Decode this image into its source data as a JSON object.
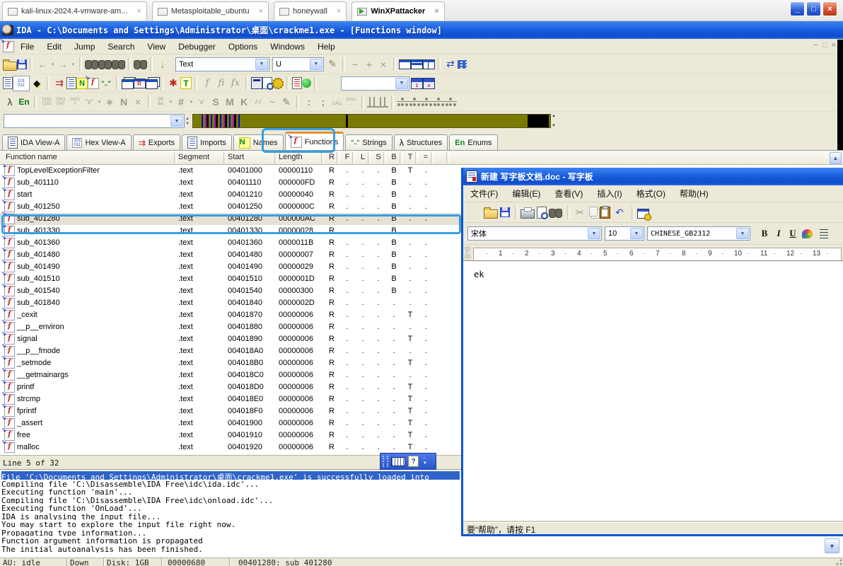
{
  "colors": {
    "titlebar_blue": "#1c5fdf",
    "toolbar_beige": "#ece9d8",
    "nav_band_olive": "#7a7a00",
    "selection_blue": "#2f63c8",
    "annotation_blue": "#389fe2"
  },
  "vm_tabs": [
    {
      "label": "kali-linux-2024.4-vmware-am...",
      "active": false
    },
    {
      "label": "Metasploitable_ubuntu",
      "active": false
    },
    {
      "label": "honeywall",
      "active": false
    },
    {
      "label": "WinXPattacker",
      "active": true
    }
  ],
  "vm_close_glyph": "×",
  "ida": {
    "title": "IDA - C:\\Documents and Settings\\Administrator\\桌面\\crackme1.exe - [Functions window]",
    "window_buttons": {
      "minimize": "_",
      "restore": "□",
      "close": "×"
    },
    "mdi_buttons": {
      "minimize": "−",
      "restore": "□",
      "close": "×"
    },
    "menus": [
      "File",
      "Edit",
      "Jump",
      "Search",
      "View",
      "Debugger",
      "Options",
      "Windows",
      "Help"
    ],
    "toolbar_row1": [
      {
        "n": "open-file-icon",
        "c": "ic-folder"
      },
      {
        "n": "save-file-icon",
        "c": "ic-floppy"
      },
      {
        "sep": true
      },
      {
        "n": "navigate-back-icon",
        "c": "dim big",
        "g": "←"
      },
      {
        "n": "navigate-back-dropdown-icon",
        "c": "dim tinyc",
        "g": "▾"
      },
      {
        "n": "navigate-forward-icon",
        "c": "dim big",
        "g": "→"
      },
      {
        "n": "navigate-forward-dropdown-icon",
        "c": "dim tinyc",
        "g": "▾"
      },
      {
        "sep": true
      },
      {
        "n": "search-memory-icon",
        "c": "ic-binoc"
      },
      {
        "n": "search-again-icon",
        "c": "ic-binoc"
      },
      {
        "n": "search-binary-icon",
        "c": "ic-binoc"
      },
      {
        "sep": true
      },
      {
        "n": "search-text-icon",
        "c": "ic-binoc"
      },
      {
        "sep": true
      },
      {
        "n": "jump-address-icon",
        "c": "dim big",
        "g": "↓"
      },
      {
        "combo": true,
        "n": "search-type-combo",
        "v": "Text",
        "c": "cb-text"
      },
      {
        "combo": true,
        "n": "search-direction-combo",
        "v": "U",
        "c": "cb-u"
      },
      {
        "n": "highlight-pencil-icon",
        "c": "pen",
        "g": "✎"
      },
      {
        "sep": true
      },
      {
        "n": "remove-item-icon",
        "c": "dim big",
        "g": "−"
      },
      {
        "n": "add-item-icon",
        "c": "dim big",
        "g": "+"
      },
      {
        "n": "delete-item-icon",
        "c": "dim big",
        "g": "×"
      },
      {
        "sep": true
      },
      {
        "n": "window-cascade-icon",
        "c": "ic-win"
      },
      {
        "n": "window-tile-horizontal-icon",
        "c": "ic-win w2"
      },
      {
        "n": "window-tile-vertical-icon",
        "c": "ic-win w3"
      },
      {
        "sep": true
      },
      {
        "n": "window-switch-icon",
        "c": "blu big",
        "g": "⇄"
      },
      {
        "n": "window-list-icon",
        "c": "ic-grid"
      }
    ],
    "toolbar_row2": [
      {
        "n": "disassembly-view-icon",
        "c": "ic-doc"
      },
      {
        "n": "hex-view-icon",
        "c": "ti-hex",
        "g": "101\n011"
      },
      {
        "n": "diamond-icon",
        "c": "dia",
        "g": "◆"
      },
      {
        "sep": true
      },
      {
        "n": "exports-icon",
        "c": "red big",
        "g": "⇉"
      },
      {
        "n": "imports-icon",
        "c": "ic-doc"
      },
      {
        "n": "names-icon",
        "c": "badge-n",
        "g": "N"
      },
      {
        "n": "functions-icon",
        "c": "fi-ic"
      },
      {
        "n": "strings-icon",
        "c": "grn small",
        "g": "\"..\""
      },
      {
        "sep": true
      },
      {
        "n": "segments-icon",
        "c": "ic-winstack"
      },
      {
        "n": "segment-registers-icon",
        "c": "ic-win wr"
      },
      {
        "n": "selectors-icon",
        "c": "ic-winstack"
      },
      {
        "sep": true
      },
      {
        "n": "signatures-flower-icon",
        "c": "red big",
        "g": "✱"
      },
      {
        "n": "type-libraries-icon",
        "c": "badge-t",
        "g": "T"
      },
      {
        "sep": true
      },
      {
        "n": "function-edit-icon",
        "c": "dim ital",
        "g": "f"
      },
      {
        "n": "function-chunk-icon",
        "c": "dim ital",
        "g": "fi"
      },
      {
        "n": "function-frame-icon",
        "c": "dim ital",
        "g": "fx"
      },
      {
        "sep": true
      },
      {
        "n": "calculator-icon",
        "c": "ic-calc"
      },
      {
        "n": "script-file-icon",
        "c": "ic-prevpage"
      },
      {
        "n": "plugins-gear-icon",
        "c": "ic-gear"
      },
      {
        "sep": true
      },
      {
        "n": "problems-list-icon",
        "c": "ic-docred"
      },
      {
        "n": "run-analysis-icon",
        "c": "ic-greendot"
      },
      {
        "sep": true
      },
      {
        "combo": true,
        "n": "breakpoint-combo",
        "v": "",
        "c": "cb-bp"
      },
      {
        "n": "breakpoint-add-icon",
        "c": "ic-bp",
        "g": "1"
      },
      {
        "n": "breakpoint-delete-icon",
        "c": "ic-bp",
        "g": "x"
      }
    ],
    "toolbar_row3": [
      {
        "n": "structures-tool-icon",
        "c": "big",
        "g": "λ"
      },
      {
        "n": "enums-tool-icon",
        "c": "grn",
        "g": "En"
      },
      {
        "sep": true
      },
      {
        "n": "make-code-icon",
        "c": "tiny2 dim",
        "g": "0101\nCOD"
      },
      {
        "n": "make-data-icon",
        "c": "tiny2 dim",
        "g": "0101\nDAT"
      },
      {
        "n": "undefine-icon",
        "c": "tiny2 dim",
        "g": "0101\n×"
      },
      {
        "n": "make-string-icon",
        "c": "dim small",
        "g": "\"s\""
      },
      {
        "n": "string-dropdown-icon",
        "c": "dim tinyc",
        "g": "▾"
      },
      {
        "n": "make-array-icon",
        "c": "dim big",
        "g": "∗"
      },
      {
        "n": "rename-icon",
        "c": "dim big bold",
        "g": "N"
      },
      {
        "n": "delete-name-icon",
        "c": "dim big",
        "g": "×"
      },
      {
        "sep": true
      },
      {
        "n": "offset-icon",
        "c": "tiny2 dim",
        "g": "Off\ndat"
      },
      {
        "n": "offset-dropdown-icon",
        "c": "dim tinyc",
        "g": "▾"
      },
      {
        "n": "number-icon",
        "c": "dim big bold",
        "g": "#"
      },
      {
        "n": "number-dropdown-icon",
        "c": "dim tinyc",
        "g": "▾"
      },
      {
        "n": "char-icon",
        "c": "dim small",
        "g": "'x'"
      },
      {
        "n": "segment-letter-icon",
        "c": "dim big bold",
        "g": "S"
      },
      {
        "n": "enum-member-icon",
        "c": "dim big bold",
        "g": "M"
      },
      {
        "n": "stack-variable-icon",
        "c": "dim big bold",
        "g": "K"
      },
      {
        "n": "struct-offset-icon",
        "c": "dim small",
        "g": "/-/"
      },
      {
        "n": "complement-icon",
        "c": "dim big",
        "g": "~"
      },
      {
        "n": "edit-pencil-icon",
        "c": "pen",
        "g": "✎"
      },
      {
        "sep": true
      },
      {
        "n": "colon-icon",
        "c": "dim big bold",
        "g": ":"
      },
      {
        "n": "semicolon-icon",
        "c": "dim big bold",
        "g": ";"
      },
      {
        "n": "extern-call-in-icon",
        "c": "tiny2 dim",
        "g": "→\nCALL"
      },
      {
        "n": "extern-call-out-icon",
        "c": "tiny2 dim",
        "g": "CALL\n→"
      },
      {
        "sep": true
      },
      {
        "n": "stack-pointer-icon",
        "c": "ic-bars"
      },
      {
        "n": "stack-change-icon",
        "c": "ic-bars"
      },
      {
        "sep": true
      },
      {
        "n": "flow-chart-icon",
        "c": "ic-tree"
      },
      {
        "n": "call-graph-icon",
        "c": "ic-tree"
      },
      {
        "n": "xrefs-to-graph-icon",
        "c": "ic-tree"
      },
      {
        "n": "xrefs-from-graph-icon",
        "c": "ic-tree"
      },
      {
        "n": "user-xrefs-graph-icon",
        "c": "ic-tree"
      }
    ],
    "tabs": [
      {
        "label": "IDA View-A",
        "icon": "ic-doc",
        "icon_name": "disassembly-view-icon",
        "active": false
      },
      {
        "label": "Hex View-A",
        "icon": "ti-hex",
        "icon_name": "hex-view-icon",
        "glyph": "101\n011",
        "active": false
      },
      {
        "label": "Exports",
        "icon": "ti-exp",
        "icon_name": "exports-icon",
        "glyph": "⇉",
        "active": false
      },
      {
        "label": "Imports",
        "icon": "ic-doc",
        "icon_name": "imports-icon",
        "active": false
      },
      {
        "label": "Names",
        "icon": "badge-n",
        "icon_name": "names-icon",
        "glyph": "N",
        "active": false
      },
      {
        "label": "Functions",
        "icon": "fi-ic",
        "icon_name": "functions-icon",
        "active": true
      },
      {
        "label": "Strings",
        "icon": "ti-str",
        "icon_name": "strings-icon",
        "glyph": "\"..\"",
        "active": false
      },
      {
        "label": "Structures",
        "icon": "ti-struct",
        "icon_name": "structures-icon",
        "glyph": "λ",
        "active": false
      },
      {
        "label": "Enums",
        "icon": "ti-en",
        "icon_name": "enums-icon",
        "glyph": "En",
        "active": false
      }
    ],
    "functions_table": {
      "columns": [
        "Function name",
        "Segment",
        "Start",
        "Length",
        "R",
        "F",
        "L",
        "S",
        "B",
        "T",
        "="
      ],
      "selected_index": 4,
      "rows": [
        {
          "name": "TopLevelExceptionFilter",
          "segment": ".text",
          "start": "00401000",
          "length": "00000110",
          "flags": [
            "R",
            ".",
            ".",
            ".",
            "B",
            "T",
            "."
          ]
        },
        {
          "name": "sub_401110",
          "segment": ".text",
          "start": "00401110",
          "length": "000000FD",
          "flags": [
            "R",
            ".",
            ".",
            ".",
            "B",
            ".",
            "."
          ]
        },
        {
          "name": "start",
          "segment": ".text",
          "start": "00401210",
          "length": "00000040",
          "flags": [
            "R",
            ".",
            ".",
            ".",
            "B",
            ".",
            "."
          ]
        },
        {
          "name": "sub_401250",
          "segment": ".text",
          "start": "00401250",
          "length": "0000000C",
          "flags": [
            "R",
            ".",
            ".",
            ".",
            "B",
            ".",
            "."
          ]
        },
        {
          "name": "sub_401280",
          "segment": ".text",
          "start": "00401280",
          "length": "000000AC",
          "flags": [
            "R",
            ".",
            ".",
            ".",
            "B",
            ".",
            "."
          ]
        },
        {
          "name": "sub_401330",
          "segment": ".text",
          "start": "00401330",
          "length": "00000028",
          "flags": [
            "R",
            ".",
            ".",
            ".",
            "B",
            ".",
            "."
          ]
        },
        {
          "name": "sub_401360",
          "segment": ".text",
          "start": "00401360",
          "length": "0000011B",
          "flags": [
            "R",
            ".",
            ".",
            ".",
            "B",
            ".",
            "."
          ]
        },
        {
          "name": "sub_401480",
          "segment": ".text",
          "start": "00401480",
          "length": "00000007",
          "flags": [
            "R",
            ".",
            ".",
            ".",
            "B",
            ".",
            "."
          ]
        },
        {
          "name": "sub_401490",
          "segment": ".text",
          "start": "00401490",
          "length": "00000029",
          "flags": [
            "R",
            ".",
            ".",
            ".",
            "B",
            ".",
            "."
          ]
        },
        {
          "name": "sub_401510",
          "segment": ".text",
          "start": "00401510",
          "length": "0000001D",
          "flags": [
            "R",
            ".",
            ".",
            ".",
            "B",
            ".",
            "."
          ]
        },
        {
          "name": "sub_401540",
          "segment": ".text",
          "start": "00401540",
          "length": "00000300",
          "flags": [
            "R",
            ".",
            ".",
            ".",
            "B",
            ".",
            "."
          ]
        },
        {
          "name": "sub_401840",
          "segment": ".text",
          "start": "00401840",
          "length": "0000002D",
          "flags": [
            "R",
            ".",
            ".",
            ".",
            ".",
            ".",
            "."
          ]
        },
        {
          "name": "_cexit",
          "segment": ".text",
          "start": "00401870",
          "length": "00000006",
          "flags": [
            "R",
            ".",
            ".",
            ".",
            ".",
            "T",
            "."
          ]
        },
        {
          "name": "__p__environ",
          "segment": ".text",
          "start": "00401880",
          "length": "00000006",
          "flags": [
            "R",
            ".",
            ".",
            ".",
            ".",
            ".",
            "."
          ]
        },
        {
          "name": "signal",
          "segment": ".text",
          "start": "00401890",
          "length": "00000006",
          "flags": [
            "R",
            ".",
            ".",
            ".",
            ".",
            "T",
            "."
          ]
        },
        {
          "name": "__p__fmode",
          "segment": ".text",
          "start": "004018A0",
          "length": "00000006",
          "flags": [
            "R",
            ".",
            ".",
            ".",
            ".",
            ".",
            "."
          ]
        },
        {
          "name": "_setmode",
          "segment": ".text",
          "start": "004018B0",
          "length": "00000006",
          "flags": [
            "R",
            ".",
            ".",
            ".",
            ".",
            "T",
            "."
          ]
        },
        {
          "name": "__getmainargs",
          "segment": ".text",
          "start": "004018C0",
          "length": "00000006",
          "flags": [
            "R",
            ".",
            ".",
            ".",
            ".",
            ".",
            "."
          ]
        },
        {
          "name": "printf",
          "segment": ".text",
          "start": "004018D0",
          "length": "00000006",
          "flags": [
            "R",
            ".",
            ".",
            ".",
            ".",
            "T",
            "."
          ]
        },
        {
          "name": "strcmp",
          "segment": ".text",
          "start": "004018E0",
          "length": "00000006",
          "flags": [
            "R",
            ".",
            ".",
            ".",
            ".",
            "T",
            "."
          ]
        },
        {
          "name": "fprintf",
          "segment": ".text",
          "start": "004018F0",
          "length": "00000006",
          "flags": [
            "R",
            ".",
            ".",
            ".",
            ".",
            "T",
            "."
          ]
        },
        {
          "name": "_assert",
          "segment": ".text",
          "start": "00401900",
          "length": "00000006",
          "flags": [
            "R",
            ".",
            ".",
            ".",
            ".",
            "T",
            "."
          ]
        },
        {
          "name": "free",
          "segment": ".text",
          "start": "00401910",
          "length": "00000006",
          "flags": [
            "R",
            ".",
            ".",
            ".",
            ".",
            "T",
            "."
          ]
        },
        {
          "name": "malloc",
          "segment": ".text",
          "start": "00401920",
          "length": "00000006",
          "flags": [
            "R",
            ".",
            ".",
            ".",
            ".",
            "T",
            "."
          ]
        }
      ]
    },
    "status_line": "Line 5 of 32",
    "output_selected_index": 0,
    "output_lines": [
      "File 'C:\\Documents and Settings\\Administrator\\桌面\\crackme1.exe' is successfully loaded into",
      "Compiling file 'C:\\Disassemble\\IDA Free\\idc\\ida.idc'...",
      "Executing function 'main'...",
      "Compiling file 'C:\\Disassemble\\IDA Free\\idc\\onload.idc'...",
      "Executing function 'OnLoad'...",
      "IDA is analysing the input file...",
      "You may start to explore the input file right now.",
      "Propagating type information...",
      "Function argument information is propagated",
      "The initial autoanalysis has been finished."
    ],
    "statusbar_segments": [
      "AU: idle",
      "Down",
      "Disk: 1GB",
      "00000680",
      "00401280: sub_401280"
    ],
    "floating_toolbar": {
      "help_glyph": "?",
      "collapse_glyph": "−",
      "expand_glyph": "▼"
    }
  },
  "wordpad": {
    "title": "新建 写字板文档.doc - 写字板",
    "menus": [
      "文件(F)",
      "编辑(E)",
      "查看(V)",
      "插入(I)",
      "格式(O)",
      "帮助(H)"
    ],
    "toolbar": [
      {
        "n": "new-document-icon",
        "c": "ic-page"
      },
      {
        "n": "open-document-icon",
        "c": "ic-folder"
      },
      {
        "n": "save-document-icon",
        "c": "ic-floppy"
      },
      {
        "sep": true
      },
      {
        "n": "print-icon",
        "c": "ic-print"
      },
      {
        "n": "print-preview-icon",
        "c": "ic-prevpage"
      },
      {
        "n": "find-icon",
        "c": "ic-binoc"
      },
      {
        "sep": true
      },
      {
        "n": "cut-icon",
        "c": "dim big",
        "g": "✂"
      },
      {
        "n": "copy-icon",
        "c": "ic-copy"
      },
      {
        "n": "paste-icon",
        "c": "ic-paste"
      },
      {
        "n": "undo-icon",
        "c": "blu big",
        "g": "↶"
      },
      {
        "sep": true
      },
      {
        "n": "datetime-icon",
        "c": "ic-date"
      }
    ],
    "format": {
      "font_name": "宋体",
      "font_size": "10",
      "charset": "CHINESE_GB2312",
      "bold_label": "B",
      "italic_label": "I",
      "underline_label": "U"
    },
    "ruler_numbers": [
      "1",
      "2",
      "3",
      "4",
      "5",
      "6",
      "7",
      "8",
      "9",
      "10",
      "11",
      "12",
      "13"
    ],
    "ruler_dot": "·",
    "document_text": "ek",
    "status": "要“帮助”，请按 F1"
  },
  "scrollbar": {
    "up_glyph": "▲",
    "down_glyph": "▼"
  },
  "nav_spin": {
    "up": "▲",
    "down": "▼"
  }
}
